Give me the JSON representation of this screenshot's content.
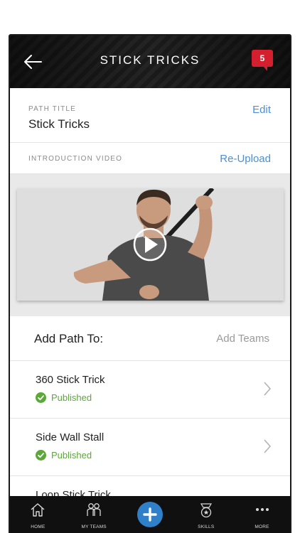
{
  "header": {
    "title": "STICK TRICKS",
    "notification_count": "5"
  },
  "path": {
    "title_label": "PATH TITLE",
    "title_value": "Stick Tricks",
    "edit_label": "Edit",
    "intro_label": "INTRODUCTION VIDEO",
    "reupload_label": "Re-Upload"
  },
  "add_path": {
    "label": "Add Path To:",
    "action": "Add Teams"
  },
  "items": [
    {
      "title": "360 Stick Trick",
      "status": "Published"
    },
    {
      "title": "Side Wall Stall",
      "status": "Published"
    },
    {
      "title": "Loop Stick Trick",
      "status": ""
    }
  ],
  "tabs": [
    {
      "label": "HOME",
      "icon": "home-icon"
    },
    {
      "label": "MY TEAMS",
      "icon": "teams-icon"
    },
    {
      "label": "",
      "icon": "add-icon"
    },
    {
      "label": "SKILLS",
      "icon": "skills-badge-icon"
    },
    {
      "label": "MORE",
      "icon": "more-icon"
    }
  ],
  "colors": {
    "accent": "#4a90d9",
    "published": "#5ba838",
    "badge": "#d4202e",
    "fab": "#2f7fc9"
  }
}
